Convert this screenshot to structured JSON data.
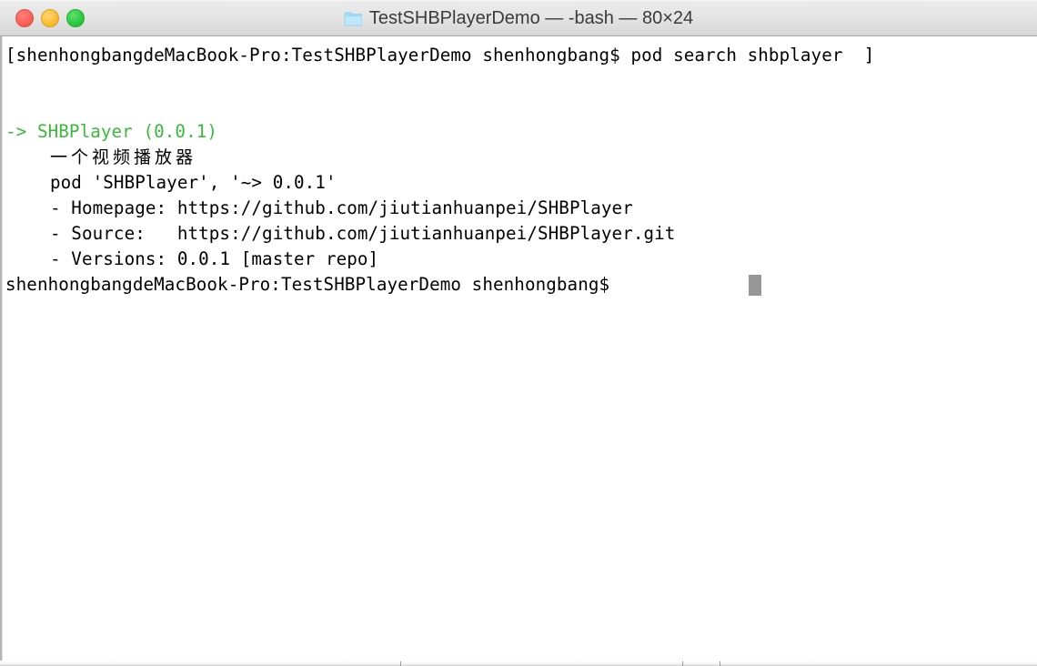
{
  "window": {
    "title": "TestSHBPlayerDemo — -bash — 80×24",
    "folder_icon": "folder-icon",
    "cols": 80,
    "rows": 24,
    "traffic_lights": [
      {
        "name": "close",
        "color": "#fb5f57"
      },
      {
        "name": "minimize",
        "color": "#fbbd2e"
      },
      {
        "name": "maximize",
        "color": "#29c73f"
      }
    ]
  },
  "terminal": {
    "background": "#ffffff",
    "foreground": "#000000",
    "accent_green": "#3cb93c",
    "cursor_color": "#969696",
    "prompt": "shenhongbangdeMacBook-Pro:TestSHBPlayerDemo shenhongbang$",
    "command": "pod search shbplayer",
    "lines": [
      {
        "id": "line-1-command",
        "text": "[shenhongbangdeMacBook-Pro:TestSHBPlayerDemo shenhongbang$ pod search shbplayer  ]",
        "color": "black"
      },
      {
        "id": "line-2-blank",
        "text": " ",
        "color": "black"
      },
      {
        "id": "line-3-blank",
        "text": " ",
        "color": "black"
      },
      {
        "id": "line-4-pod-name",
        "text": "-> SHBPlayer (0.0.1)",
        "color": "green"
      },
      {
        "id": "line-5-description",
        "text": "一个视频播放器",
        "color": "black"
      },
      {
        "id": "line-6-podfile",
        "text": "pod 'SHBPlayer', '~> 0.0.1'",
        "color": "black"
      },
      {
        "id": "line-7-homepage",
        "text": "- Homepage: https://github.com/jiutianhuanpei/SHBPlayer",
        "color": "black"
      },
      {
        "id": "line-8-source",
        "text": "- Source:   https://github.com/jiutianhuanpei/SHBPlayer.git",
        "color": "black"
      },
      {
        "id": "line-9-versions",
        "text": "- Versions: 0.0.1 [master repo]",
        "color": "black"
      },
      {
        "id": "line-10-prompt",
        "text": "shenhongbangdeMacBook-Pro:TestSHBPlayerDemo shenhongbang$ ",
        "color": "black"
      }
    ]
  }
}
